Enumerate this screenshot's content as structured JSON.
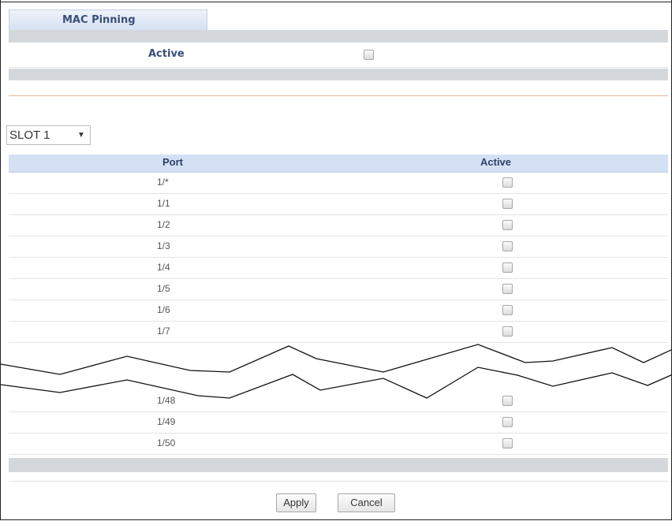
{
  "tab": {
    "label": "MAC Pinning"
  },
  "active_setting": {
    "label": "Active",
    "checked": false
  },
  "slot_select": {
    "value": "SLOT 1",
    "arrow": "▼"
  },
  "table": {
    "headers": {
      "port": "Port",
      "active": "Active"
    },
    "rows_top": [
      {
        "port": "1/*",
        "active": false
      },
      {
        "port": "1/1",
        "active": false
      },
      {
        "port": "1/2",
        "active": false
      },
      {
        "port": "1/3",
        "active": false
      },
      {
        "port": "1/4",
        "active": false
      },
      {
        "port": "1/5",
        "active": false
      },
      {
        "port": "1/6",
        "active": false
      },
      {
        "port": "1/7",
        "active": false
      }
    ],
    "rows_bottom": [
      {
        "port": "1/48",
        "active": false
      },
      {
        "port": "1/49",
        "active": false
      },
      {
        "port": "1/50",
        "active": false
      }
    ]
  },
  "buttons": {
    "apply": "Apply",
    "cancel": "Cancel"
  }
}
